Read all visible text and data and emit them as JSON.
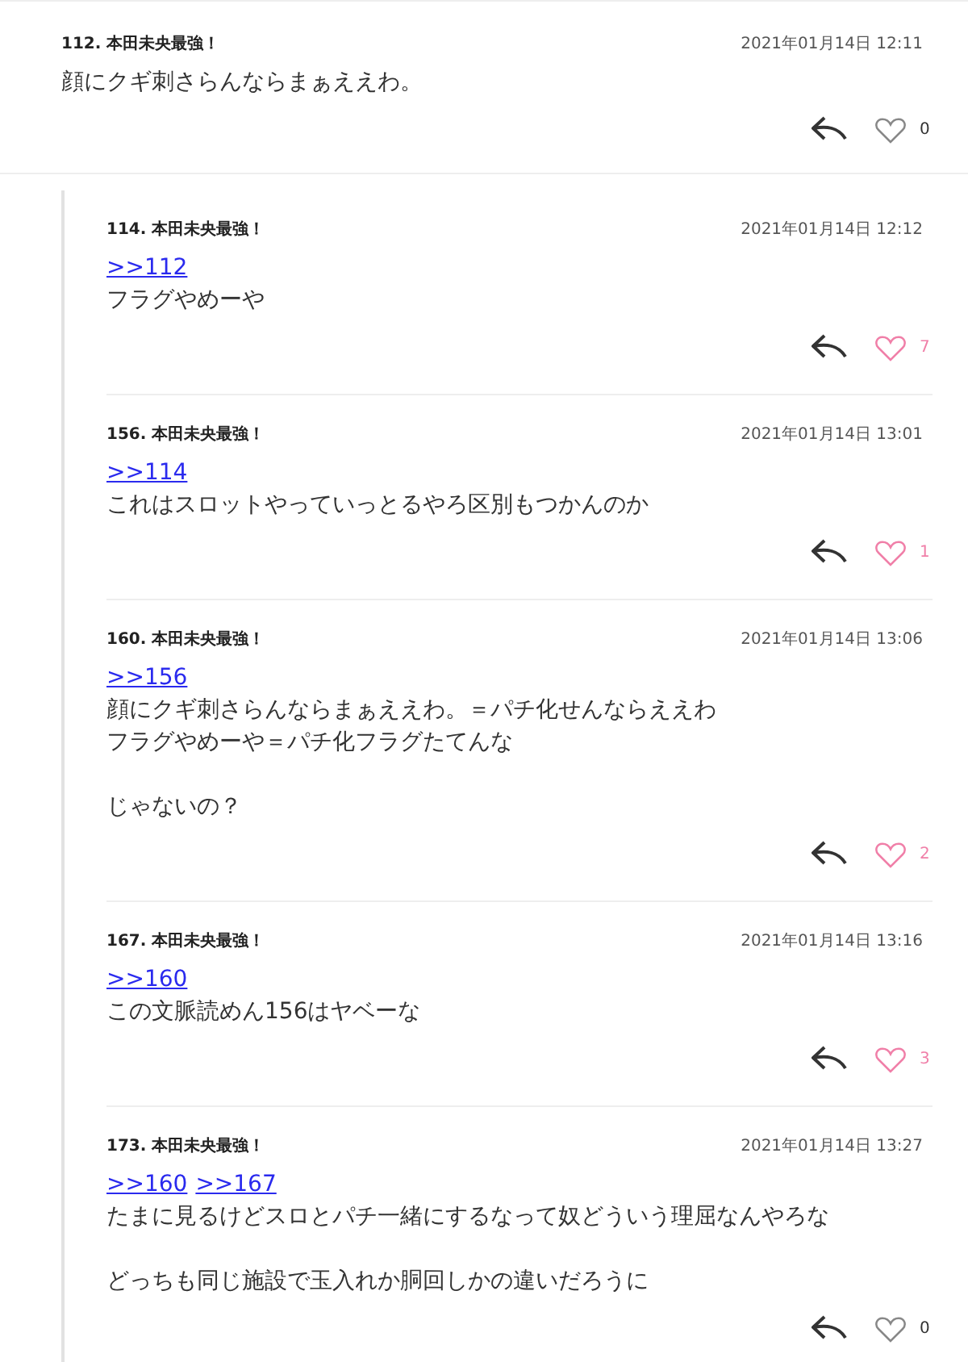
{
  "comment": {
    "number": "112.",
    "author": "本田未央最強！",
    "date": "2021年01月14日 12:11",
    "paragraphs": [
      [
        "顔にクギ刺さらんならまぁええわ。"
      ]
    ],
    "likes": "0",
    "liked": false
  },
  "replies": [
    {
      "number": "114.",
      "author": "本田未央最強！",
      "date": "2021年01月14日 12:12",
      "anchors": [
        ">>112"
      ],
      "paragraphs": [
        [
          "フラグやめーや"
        ]
      ],
      "likes": "7",
      "liked": true
    },
    {
      "number": "156.",
      "author": "本田未央最強！",
      "date": "2021年01月14日 13:01",
      "anchors": [
        ">>114"
      ],
      "paragraphs": [
        [
          "これはスロットやっていっとるやろ区別もつかんのか"
        ]
      ],
      "likes": "1",
      "liked": true
    },
    {
      "number": "160.",
      "author": "本田未央最強！",
      "date": "2021年01月14日 13:06",
      "anchors": [
        ">>156"
      ],
      "paragraphs": [
        [
          "顔にクギ刺さらんならまぁええわ。＝パチ化せんならええわ",
          "フラグやめーや＝パチ化フラグたてんな"
        ],
        [
          "じゃないの？"
        ]
      ],
      "likes": "2",
      "liked": true
    },
    {
      "number": "167.",
      "author": "本田未央最強！",
      "date": "2021年01月14日 13:16",
      "anchors": [
        ">>160"
      ],
      "paragraphs": [
        [
          "この文脈読めん156はヤベーな"
        ]
      ],
      "likes": "3",
      "liked": true
    },
    {
      "number": "173.",
      "author": "本田未央最強！",
      "date": "2021年01月14日 13:27",
      "anchors": [
        ">>160",
        ">>167"
      ],
      "paragraphs": [
        [
          "たまに見るけどスロとパチ一緒にするなって奴どういう理屈なんやろな"
        ],
        [
          "どっちも同じ施設で玉入れか胴回しかの違いだろうに"
        ]
      ],
      "likes": "0",
      "liked": false
    }
  ]
}
